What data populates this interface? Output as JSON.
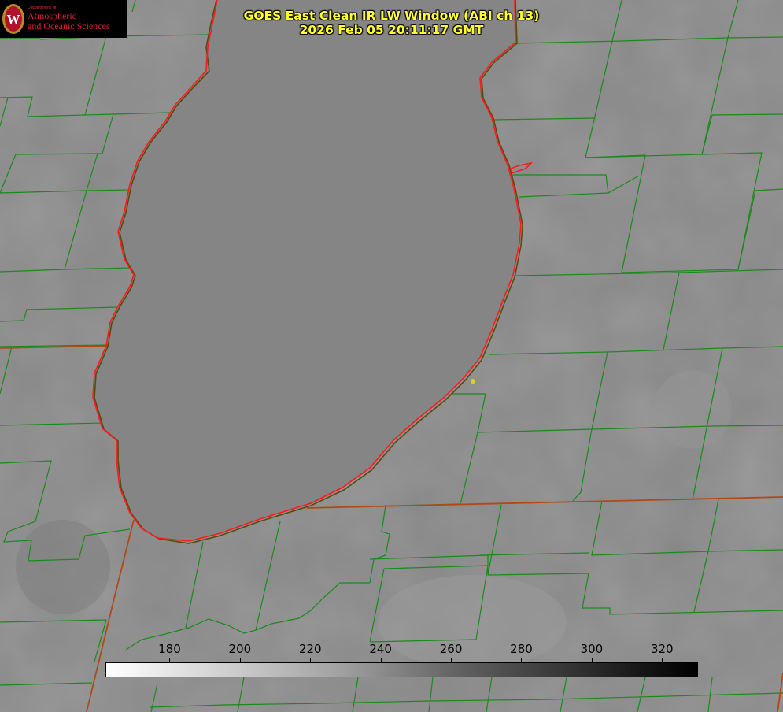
{
  "title": {
    "line1": "GOES East Clean IR LW Window (ABI ch 13)",
    "line2": "2026 Feb 05 20:11:17 GMT"
  },
  "logo": {
    "dept": "Department of",
    "line1": "Atmospheric",
    "line2": "and Oceanic Sciences",
    "seal_letter": "W"
  },
  "colorbar": {
    "min": 162,
    "max": 330,
    "ticks": [
      {
        "value": 180,
        "label": "180"
      },
      {
        "value": 200,
        "label": "200"
      },
      {
        "value": 220,
        "label": "220"
      },
      {
        "value": 240,
        "label": "240"
      },
      {
        "value": 260,
        "label": "260"
      },
      {
        "value": 280,
        "label": "280"
      },
      {
        "value": 300,
        "label": "300"
      },
      {
        "value": 320,
        "label": "320"
      }
    ]
  },
  "colors": {
    "background_gray": "#8a8a8a",
    "lake_gray": "#868686",
    "county_lines": "#1a8a1a",
    "state_lines": "#b04a14",
    "shoreline": "#ff1a1a",
    "title_text": "#ffff33",
    "marker": "#e0d020"
  }
}
